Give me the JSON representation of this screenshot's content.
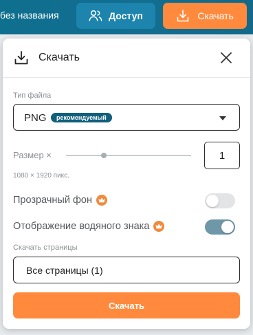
{
  "topbar": {
    "doc_title": "без названия",
    "access_label": "Доступ",
    "download_label": "Скачать"
  },
  "panel": {
    "title": "Скачать",
    "file_type": {
      "label": "Тип файла",
      "value": "PNG",
      "badge": "рекомендуемый"
    },
    "size": {
      "label": "Размер ×",
      "value": "1",
      "dimensions": "1080 × 1920 пикс.",
      "slider_fraction": 0.3
    },
    "options": [
      {
        "label": "Прозрачный фон",
        "enabled": false,
        "premium": true
      },
      {
        "label": "Отображение водяного знака",
        "enabled": true,
        "premium": true
      }
    ],
    "pages": {
      "label": "Скачать страницы",
      "value": "Все страницы (1)"
    },
    "download_button": "Скачать"
  },
  "colors": {
    "topbar": "#136e90",
    "accent_orange": "#ff8a3d",
    "badge": "#10607c",
    "toggle_on": "#6e97a8"
  },
  "icons": {
    "access": "users-icon",
    "download": "download-icon",
    "close": "close-icon",
    "caret": "caret-down-icon",
    "premium": "crown-icon"
  }
}
